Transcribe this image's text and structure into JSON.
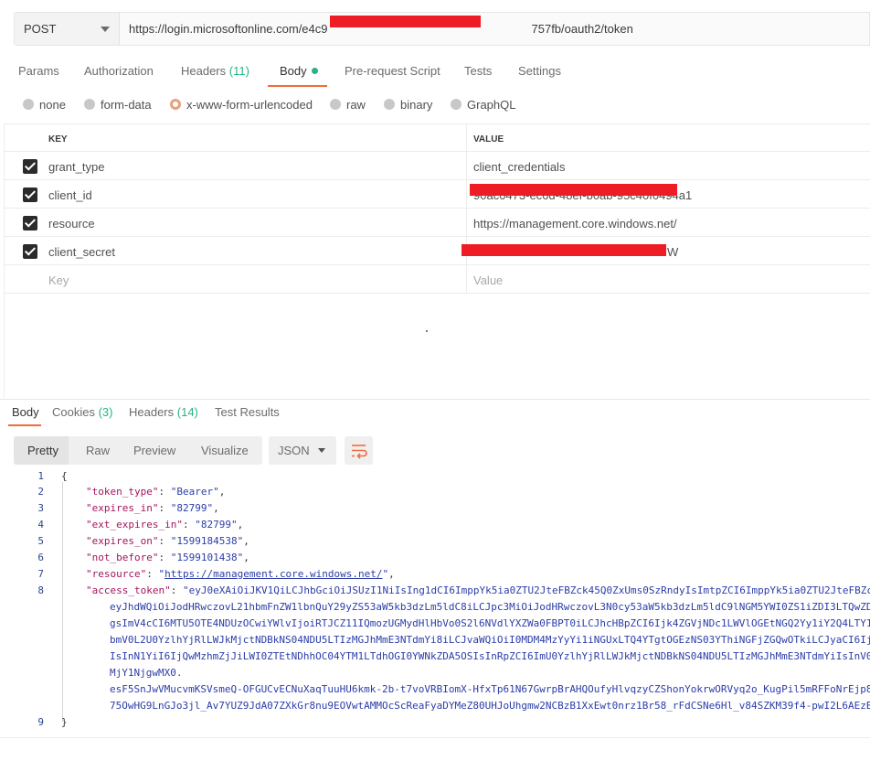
{
  "request": {
    "method": "POST",
    "url": "https://login.microsoftonline.com/e4c9a8 1e-8827-4... -2300a2a757fb/oauth2/token",
    "url_prefix": "https://login.microsoftonline.com/e4c9",
    "url_suffix": "757fb/oauth2/token"
  },
  "request_tabs": [
    {
      "label": "Params"
    },
    {
      "label": "Authorization"
    },
    {
      "label": "Headers",
      "count": "(11)"
    },
    {
      "label": "Body"
    },
    {
      "label": "Pre-request Script"
    },
    {
      "label": "Tests"
    },
    {
      "label": "Settings"
    }
  ],
  "body_types": [
    "none",
    "form-data",
    "x-www-form-urlencoded",
    "raw",
    "binary",
    "GraphQL"
  ],
  "body_type_selected": "x-www-form-urlencoded",
  "params": {
    "header": {
      "key": "KEY",
      "value": "VALUE"
    },
    "rows": [
      {
        "key": "grant_type",
        "value": "client_credentials",
        "checked": true
      },
      {
        "key": "client_id",
        "value": "90ac0473-ec6d-48ef-b0ab-95c40f0494a1",
        "checked": true
      },
      {
        "key": "resource",
        "value": "https://management.core.windows.net/",
        "checked": true
      },
      {
        "key": "client_secret",
        "value": "W",
        "checked": true
      }
    ],
    "placeholder": {
      "key": "Key",
      "value": "Value"
    }
  },
  "response_tabs": [
    {
      "label": "Body"
    },
    {
      "label": "Cookies",
      "count": "(3)"
    },
    {
      "label": "Headers",
      "count": "(14)"
    },
    {
      "label": "Test Results"
    }
  ],
  "view_modes": [
    "Pretty",
    "Raw",
    "Preview",
    "Visualize"
  ],
  "format": "JSON",
  "code": {
    "line_numbers": [
      "1",
      "2",
      "3",
      "4",
      "5",
      "6",
      "7",
      "8",
      "9"
    ],
    "open_brace": "{",
    "close_brace": "}",
    "token_type_key": "\"token_type\"",
    "token_type_val": "\"Bearer\"",
    "expires_in_key": "\"expires_in\"",
    "expires_in_val": "\"82799\"",
    "ext_expires_in_key": "\"ext_expires_in\"",
    "ext_expires_in_val": "\"82799\"",
    "expires_on_key": "\"expires_on\"",
    "expires_on_val": "\"1599184538\"",
    "not_before_key": "\"not_before\"",
    "not_before_val": "\"1599101438\"",
    "resource_key": "\"resource\"",
    "resource_val": "https://management.core.windows.net/",
    "access_token_key": "\"access_token\"",
    "token_lines": [
      "\"eyJ0eXAiOiJKV1QiLCJhbGciOiJSUzI1NiIsIng1dCI6ImppYk5ia0ZTU2JteFBZck45Q0ZxUms0SzRndyIsImtpZCI6ImppYk5ia0ZTU2JteFBZc",
      "eyJhdWQiOiJodHRwczovL21hbmFnZW1lbnQuY29yZS53aW5kb3dzLm5ldC8iLCJpc3MiOiJodHRwczovL3N0cy53aW5kb3dzLm5ldC9lNGM5YWI0ZS1iZDI3LTQwZD",
      "gsImV4cCI6MTU5OTE4NDUzOCwiYWlvIjoiRTJCZ11IQmozUGMydHlHbVo0S2l6NVdlYXZWa0FBPT0iLCJhcHBpZCI6Ijk4ZGVjNDc1LWVlOGEtNGQ2Yy1iY2Q4LTY1",
      "bmV0L2U0YzlhYjRlLWJkMjctNDBkNS04NDU5LTIzMGJhMmE3NTdmYi8iLCJvaWQiOiI0MDM4MzYyYi1iNGUxLTQ4YTgtOGEzNS03YThiNGFjZGQwOTkiLCJyaCI6Ij",
      "IsInN1YiI6IjQwMzhmZjJiLWI0ZTEtNDhhOC04YTM1LTdhOGI0YWNkZDA5OSIsInRpZCI6ImU0YzlhYjRlLWJkMjctNDBkNS04NDU5LTIzMGJhMmE3NTdmYiIsInV0",
      "MjY1NjgwMX0.",
      "esF5SnJwVMucvmKSVsmeQ-OFGUCvECNuXaqTuuHU6kmk-2b-t7voVRBIomX-HfxTp61N67GwrpBrAHQOufyHlvqzyCZShonYokrwORVyq2o_KugPil5mRFFoNrEjp8",
      "75OwHG9LnGJo3jl_Av7YUZ9JdA07ZXkGr8nu9EOVwtAMMOcScReaFyaDYMeZ80UHJoUhgmw2NCBzB1XxEwt0nrz1Br58_rFdCSNe6Hl_v84SZKM39f4-pwI2L6AEzB"
    ]
  }
}
